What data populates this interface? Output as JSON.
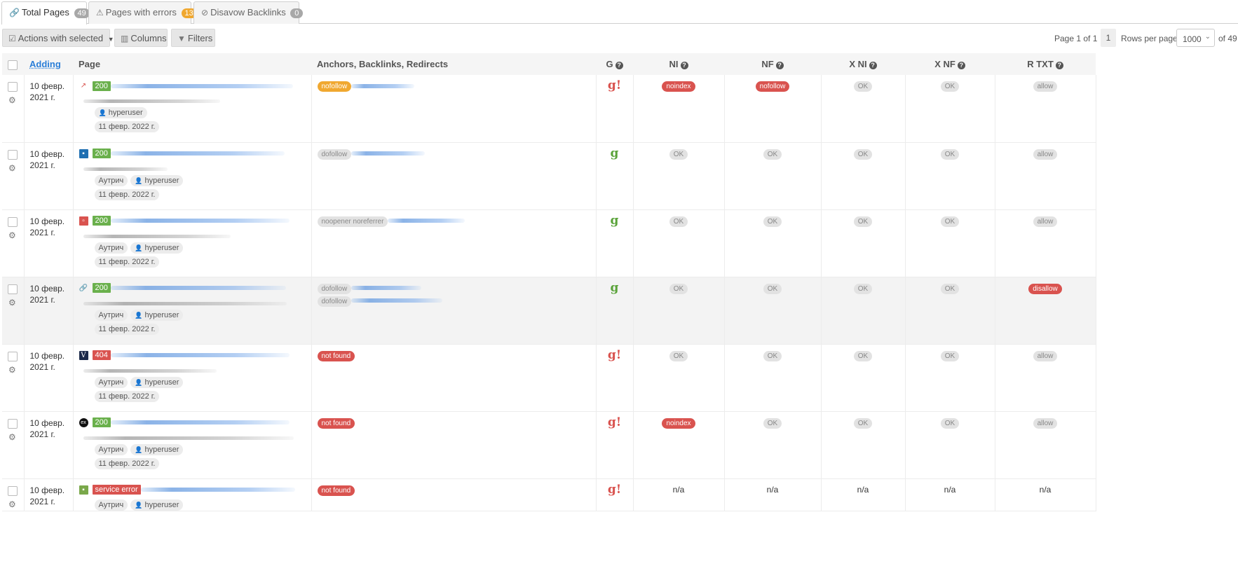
{
  "tabs": [
    {
      "icon": "link-icon",
      "label": "Total Pages",
      "count": "49"
    },
    {
      "icon": "warning-icon",
      "label": "Pages with errors",
      "count": "13"
    },
    {
      "icon": "ban-icon",
      "label": "Disavow Backlinks",
      "count": "0"
    }
  ],
  "toolbar": {
    "actions_label": "Actions with selected",
    "columns_label": "Columns",
    "filters_label": "Filters"
  },
  "pager": {
    "page_text": "Page 1 of 1",
    "page_number": "1",
    "rows_label": "Rows per page",
    "rows_value": "1000",
    "of_total": "of 49"
  },
  "table": {
    "headers": {
      "adding": "Adding",
      "page": "Page",
      "anchors": "Anchors, Backlinks, Redirects",
      "g": "G",
      "ni": "NI",
      "nf": "NF",
      "xni": "X NI",
      "xnf": "X NF",
      "rtxt": "R TXT"
    },
    "rows": [
      {
        "date1": "10 февр.",
        "date2": "2021 г.",
        "status": "200",
        "tags": [
          "hyperuser"
        ],
        "checked": "11 февр. 2022 г.",
        "anchors": [
          "nofollow"
        ],
        "ni": "noindex",
        "nf": "nofollow",
        "xni": "OK",
        "xnf": "OK",
        "rtxt": "allow"
      },
      {
        "date1": "10 февр.",
        "date2": "2021 г.",
        "status": "200",
        "tags": [
          "Аутрич",
          "hyperuser"
        ],
        "checked": "11 февр. 2022 г.",
        "anchors": [
          "dofollow"
        ],
        "ni": "OK",
        "nf": "OK",
        "xni": "OK",
        "xnf": "OK",
        "rtxt": "allow"
      },
      {
        "date1": "10 февр.",
        "date2": "2021 г.",
        "status": "200",
        "tags": [
          "Аутрич",
          "hyperuser"
        ],
        "checked": "11 февр. 2022 г.",
        "anchors": [
          "noopener noreferrer"
        ],
        "ni": "OK",
        "nf": "OK",
        "xni": "OK",
        "xnf": "OK",
        "rtxt": "allow"
      },
      {
        "date1": "10 февр.",
        "date2": "2021 г.",
        "status": "200",
        "tags": [
          "Аутрич",
          "hyperuser"
        ],
        "checked": "11 февр. 2022 г.",
        "anchors": [
          "dofollow",
          "dofollow"
        ],
        "ni": "OK",
        "nf": "OK",
        "xni": "OK",
        "xnf": "OK",
        "rtxt": "disallow"
      },
      {
        "date1": "10 февр.",
        "date2": "2021 г.",
        "status": "404",
        "tags": [
          "Аутрич",
          "hyperuser"
        ],
        "checked": "11 февр. 2022 г.",
        "anchors": [
          "not found"
        ],
        "ni": "OK",
        "nf": "OK",
        "xni": "OK",
        "xnf": "OK",
        "rtxt": "allow"
      },
      {
        "date1": "10 февр.",
        "date2": "2021 г.",
        "status": "200",
        "tags": [
          "Аутрич",
          "hyperuser"
        ],
        "checked": "11 февр. 2022 г.",
        "anchors": [
          "not found"
        ],
        "ni": "noindex",
        "nf": "OK",
        "xni": "OK",
        "xnf": "OK",
        "rtxt": "allow"
      },
      {
        "date1": "10 февр.",
        "date2": "2021 г.",
        "status": "service error",
        "tags": [
          "Аутрич",
          "hyperuser"
        ],
        "checked": "",
        "anchors": [
          "not found"
        ],
        "ni": "n/a",
        "nf": "n/a",
        "xni": "n/a",
        "xnf": "n/a",
        "rtxt": "n/a"
      }
    ]
  },
  "colors": {
    "accent": "#2a7ed8",
    "ok": "#6ab04c",
    "error": "#d9534f",
    "warning": "#f0a830"
  }
}
